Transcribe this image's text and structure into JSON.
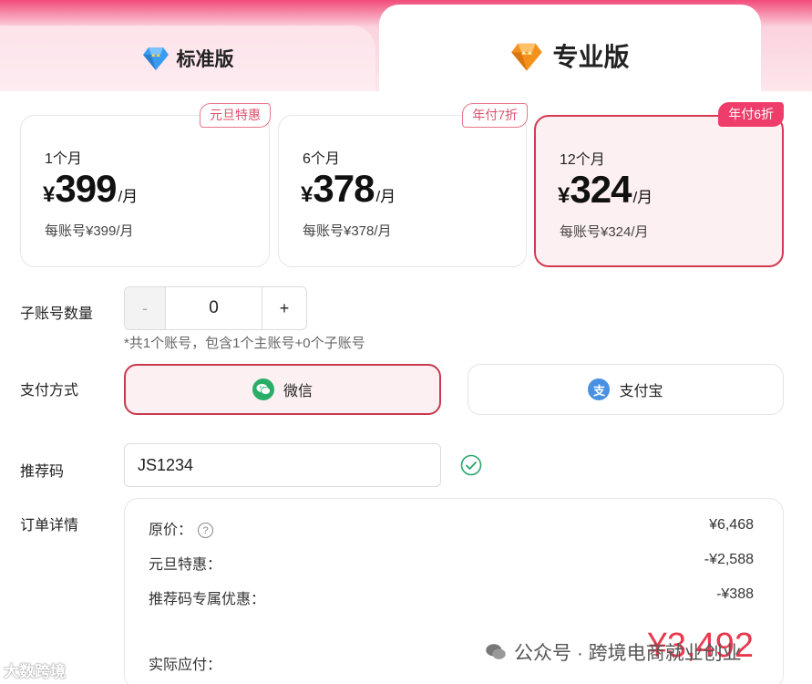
{
  "tabs": {
    "standard_label": "标准版",
    "pro_label": "专业版"
  },
  "plans": [
    {
      "badge": "元旦特惠",
      "term": "1个月",
      "currency": "¥",
      "price": "399",
      "unit": "/月",
      "per_account": "每账号¥399/月"
    },
    {
      "badge": "年付7折",
      "term": "6个月",
      "currency": "¥",
      "price": "378",
      "unit": "/月",
      "per_account": "每账号¥378/月"
    },
    {
      "badge": "年付6折",
      "term": "12个月",
      "currency": "¥",
      "price": "324",
      "unit": "/月",
      "per_account": "每账号¥324/月"
    }
  ],
  "sub_accounts": {
    "label": "子账号数量",
    "minus": "-",
    "value": "0",
    "plus": "+",
    "hint": "*共1个账号，包含1个主账号+0个子账号"
  },
  "payment": {
    "label": "支付方式",
    "wechat": "微信",
    "alipay": "支付宝",
    "alipay_icon_char": "支"
  },
  "referral": {
    "label": "推荐码",
    "value": "JS1234"
  },
  "order": {
    "label": "订单详情",
    "original_label": "原价：",
    "original_value": "¥6,468",
    "promo_label": "元旦特惠：",
    "promo_value": "-¥2,588",
    "referral_label": "推荐码专属优惠：",
    "referral_value": "-¥388",
    "total_label": "实际应付：",
    "total_value": "¥3,492"
  },
  "watermarks": {
    "left": "大数跨境",
    "right": "公众号 · 跨境电商就业创业"
  },
  "colors": {
    "accent": "#e8394d",
    "selected_border": "#d33a52",
    "wechat": "#2aae67",
    "alipay": "#4a90e2",
    "diamond_blue": "#3a9cf0",
    "diamond_orange": "#f2921d"
  }
}
